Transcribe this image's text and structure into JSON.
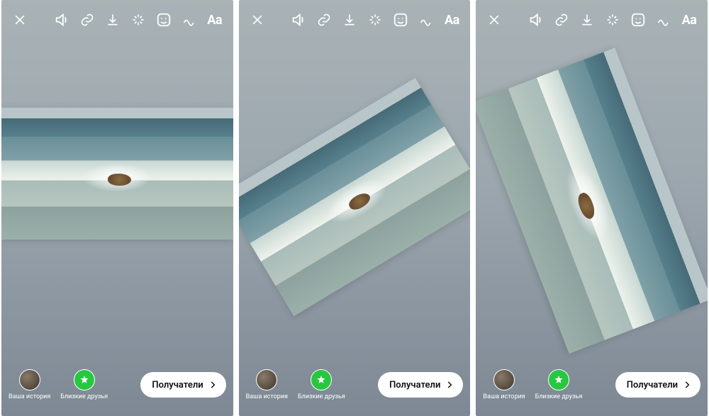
{
  "toolbar": {
    "close": "close-icon",
    "sound": "sound-icon",
    "link": "link-icon",
    "save": "download-icon",
    "effects": "sparkle-icon",
    "sticker": "sticker-icon",
    "draw": "draw-icon",
    "text_label": "Aa"
  },
  "bottom": {
    "your_story_label": "Ваша история",
    "close_friends_label": "Близкие друзья",
    "recipients_label": "Получатели"
  },
  "panels": [
    {
      "photo_rotation_deg": 0,
      "photo_scale": 1.0
    },
    {
      "photo_rotation_deg": -31,
      "photo_scale": 1.0
    },
    {
      "photo_rotation_deg": 69,
      "photo_scale": 1.15
    }
  ]
}
